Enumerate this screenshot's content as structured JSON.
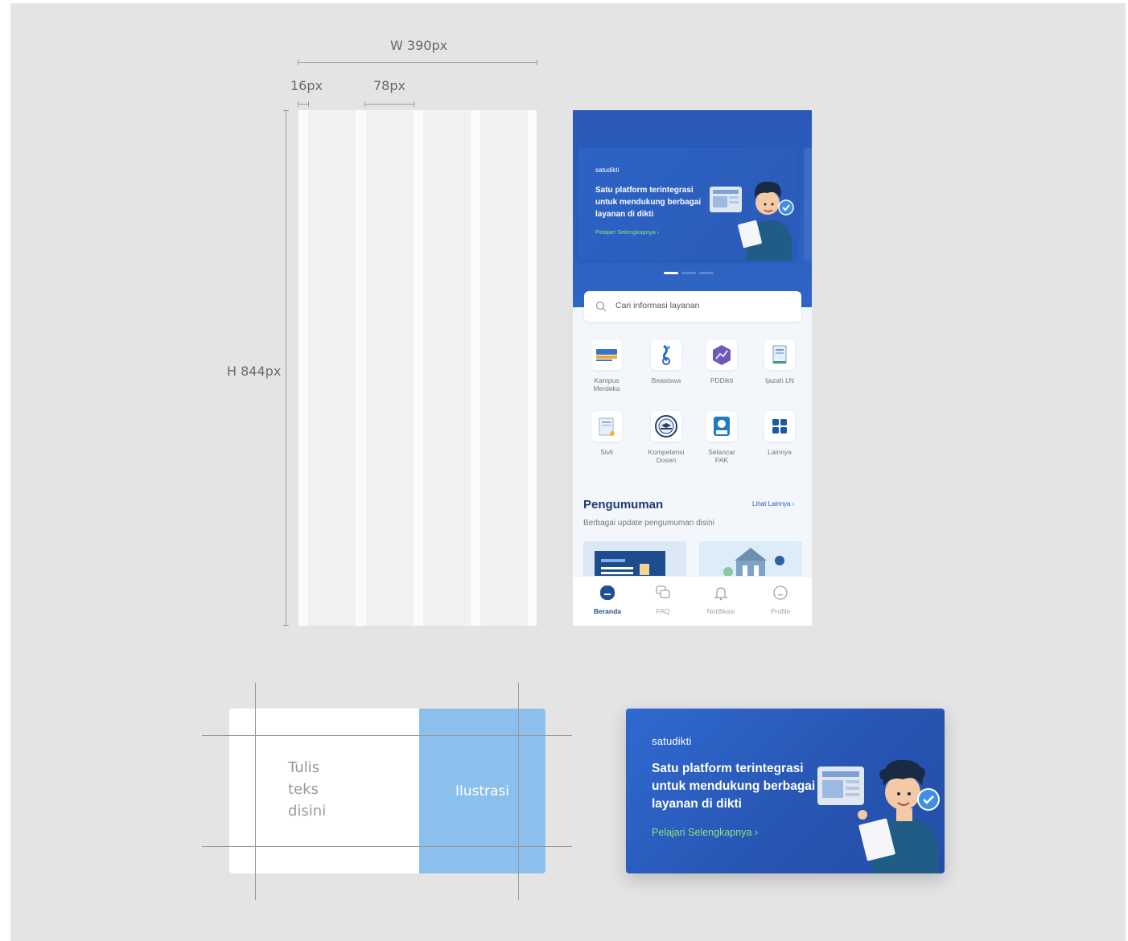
{
  "spec": {
    "width_label": "W 390px",
    "margin_label": "16px",
    "column_label": "78px",
    "height_label": "H 844px"
  },
  "phone": {
    "banner": {
      "logo": "satudikti",
      "title": "Satu platform terintegrasi untuk mendukung berbagai layanan di dikti",
      "link": "Pelajari Selengkapnya  ›"
    },
    "search": {
      "placeholder": "Cari informasi layanan"
    },
    "services": [
      {
        "label": "Kampus\nMerdeka",
        "icon": "kampus-merdeka-logo"
      },
      {
        "label": "Beasiswa",
        "icon": "beasiswa-icon"
      },
      {
        "label": "PDDikti",
        "icon": "pddikti-icon"
      },
      {
        "label": "Ijazah LN",
        "icon": "ijazah-icon"
      },
      {
        "label": "Sivil",
        "icon": "sivil-icon"
      },
      {
        "label": "Kompetensi\nDosen",
        "icon": "kompetensi-icon"
      },
      {
        "label": "Selancar\nPAK",
        "icon": "selancar-icon"
      },
      {
        "label": "Lainnya",
        "icon": "grid-icon"
      }
    ],
    "announcements": {
      "title": "Pengumuman",
      "link": "Lihat Lainnya  ›",
      "subtitle": "Berbagai update pengumuman disini"
    },
    "tabs": [
      {
        "label": "Beranda",
        "icon": "home-icon",
        "active": true
      },
      {
        "label": "FAQ",
        "icon": "faq-icon",
        "active": false
      },
      {
        "label": "Notifikasi",
        "icon": "bell-icon",
        "active": false
      },
      {
        "label": "Profile",
        "icon": "profile-icon",
        "active": false
      }
    ]
  },
  "sketch": {
    "text": "Tulis\nteks\ndisini",
    "illustration": "Ilustrasi"
  },
  "banner_large": {
    "logo": "satudikti",
    "title": "Satu platform terintegrasi untuk mendukung berbagai layanan di dikti",
    "link": "Pelajari Selengkapnya  ›"
  },
  "colors": {
    "primary": "#2b5fc0",
    "accent_green": "#8fe07a",
    "sketch_blue": "#8cc0ec"
  }
}
